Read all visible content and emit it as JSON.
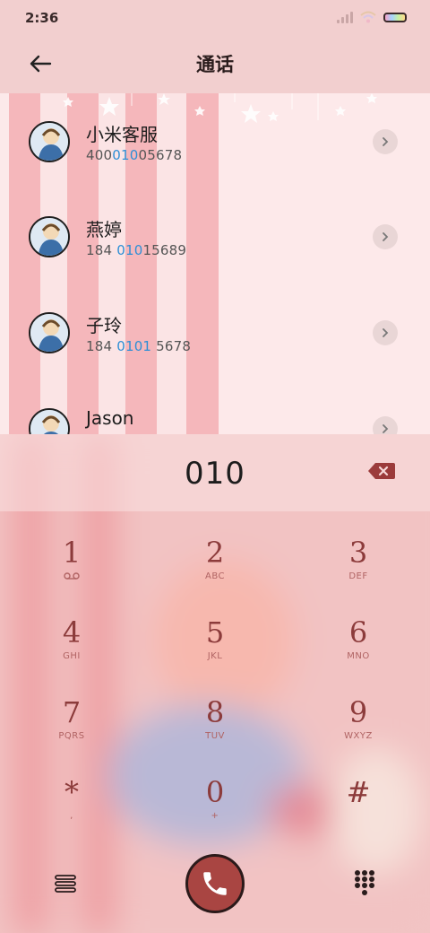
{
  "status_bar": {
    "time": "2:36"
  },
  "header": {
    "title": "通话"
  },
  "contacts": [
    {
      "name": "小米客服",
      "number_parts": [
        "400",
        "010",
        "05678"
      ]
    },
    {
      "name": "燕婷",
      "number_parts": [
        "184 ",
        "010",
        "15689"
      ]
    },
    {
      "name": "子玲",
      "number_parts": [
        "184 ",
        "0101",
        " 5678"
      ]
    },
    {
      "name": "Jason",
      "number_parts": [
        "",
        "",
        ""
      ]
    }
  ],
  "dialer": {
    "number": "010",
    "keys": [
      {
        "digit": "1",
        "letters": ""
      },
      {
        "digit": "2",
        "letters": "ABC"
      },
      {
        "digit": "3",
        "letters": "DEF"
      },
      {
        "digit": "4",
        "letters": "GHI"
      },
      {
        "digit": "5",
        "letters": "JKL"
      },
      {
        "digit": "6",
        "letters": "MNO"
      },
      {
        "digit": "7",
        "letters": "PQRS"
      },
      {
        "digit": "8",
        "letters": "TUV"
      },
      {
        "digit": "9",
        "letters": "WXYZ"
      },
      {
        "digit": "*",
        "letters": ","
      },
      {
        "digit": "0",
        "letters": "+"
      },
      {
        "digit": "#",
        "letters": ""
      }
    ]
  },
  "icons": {
    "back": "arrow-left-icon",
    "chevron": "chevron-right-icon",
    "backspace": "backspace-icon",
    "voicemail": "voicemail-icon",
    "menu": "menu-icon",
    "call": "phone-icon",
    "keypad": "keypad-icon"
  },
  "colors": {
    "highlight": "#2e8fd6",
    "call_button": "#a94542",
    "key_text": "#8c3b3b"
  }
}
